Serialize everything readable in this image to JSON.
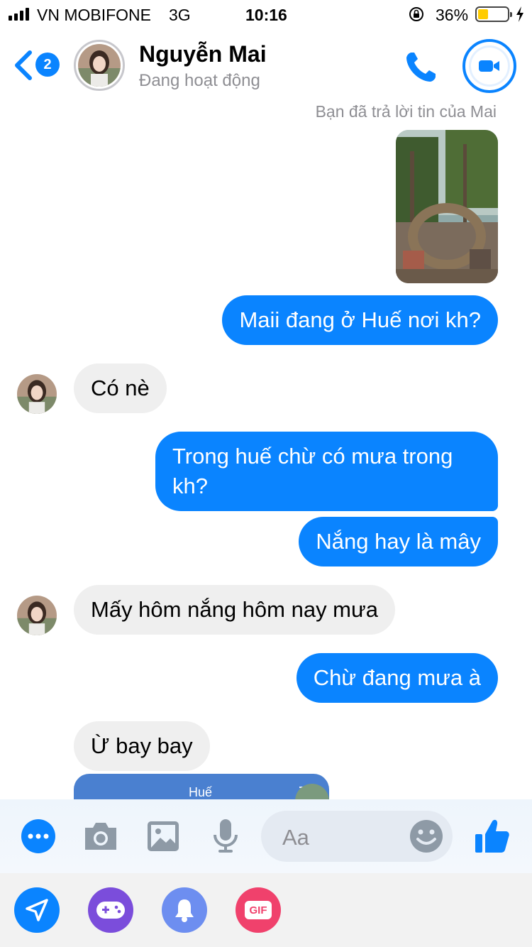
{
  "status_bar": {
    "carrier": "VN MOBIFONE",
    "network": "3G",
    "time": "10:16",
    "battery_text": "36%",
    "battery_level": 0.36
  },
  "header": {
    "badge_count": "2",
    "contact_name": "Nguyễn Mai",
    "contact_status": "Đang hoạt động",
    "icons": [
      "chevron-left-icon",
      "phone-icon",
      "video-camera-icon"
    ]
  },
  "conversation": {
    "reply_note": "Bạn đã trả lời tin của Mai",
    "messages": [
      {
        "from": "me",
        "text": "Maii đang ở Huế nơi kh?"
      },
      {
        "from": "them",
        "text": "Có nè"
      },
      {
        "from": "me",
        "text": "Trong huế chừ có mưa trong kh?"
      },
      {
        "from": "me",
        "text": "Nắng hay là mây"
      },
      {
        "from": "them",
        "text": "Mấy hôm nắng hôm nay mưa"
      },
      {
        "from": "me",
        "text": "Chừ đang mưa à"
      },
      {
        "from": "them",
        "text": "Ừ bay bay"
      }
    ],
    "shared_card_label": "Huế"
  },
  "composer": {
    "placeholder": "Aa",
    "icons": [
      "more-icon",
      "camera-icon",
      "image-icon",
      "microphone-icon",
      "emoji-icon",
      "like-icon"
    ]
  },
  "tray": {
    "gif_label": "GIF",
    "icons": [
      "send-location-icon",
      "game-controller-icon",
      "bell-icon",
      "gif-icon"
    ]
  },
  "colors": {
    "accent": "#0a84ff",
    "incoming_bubble": "#efefef",
    "game_purple": "#7b4ddb",
    "bell_blue": "#6d8ef0",
    "gif_pink": "#f0416c"
  }
}
